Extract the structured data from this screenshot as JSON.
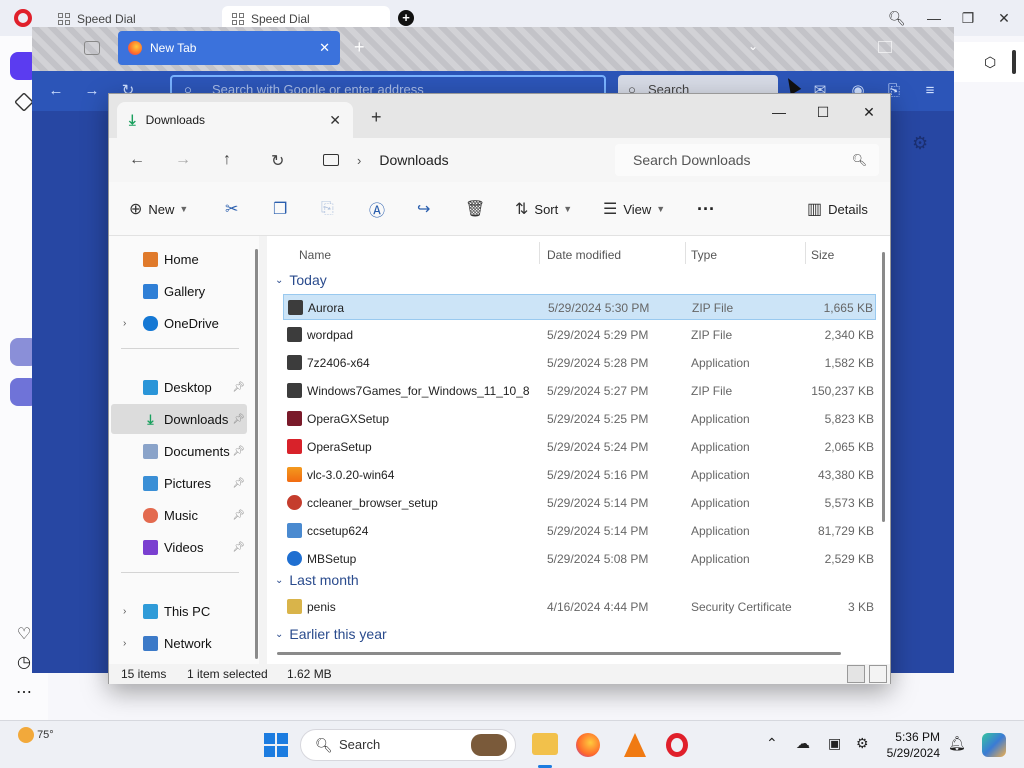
{
  "opera": {
    "tabs": [
      {
        "label": "Speed Dial"
      },
      {
        "label": "Speed Dial"
      }
    ]
  },
  "firefox": {
    "tab_label": "New Tab",
    "url_placeholder": "Search with Google or enter address",
    "search_placeholder": "Search"
  },
  "explorer": {
    "tab_label": "Downloads",
    "breadcrumb": "Downloads",
    "search_placeholder": "Search Downloads",
    "commands": {
      "new": "New",
      "sort": "Sort",
      "view": "View",
      "more": "···",
      "details": "Details"
    },
    "nav": [
      {
        "label": "Home"
      },
      {
        "label": "Gallery"
      },
      {
        "label": "OneDrive"
      },
      {
        "label": "Desktop"
      },
      {
        "label": "Downloads"
      },
      {
        "label": "Documents"
      },
      {
        "label": "Pictures"
      },
      {
        "label": "Music"
      },
      {
        "label": "Videos"
      },
      {
        "label": "This PC"
      },
      {
        "label": "Network"
      }
    ],
    "columns": {
      "name": "Name",
      "date": "Date modified",
      "type": "Type",
      "size": "Size"
    },
    "groups": {
      "today": "Today",
      "last_month": "Last month",
      "earlier": "Earlier this year"
    },
    "files": [
      {
        "name": "Aurora",
        "date": "5/29/2024 5:30 PM",
        "type": "ZIP File",
        "size": "1,665 KB"
      },
      {
        "name": "wordpad",
        "date": "5/29/2024 5:29 PM",
        "type": "ZIP File",
        "size": "2,340 KB"
      },
      {
        "name": "7z2406-x64",
        "date": "5/29/2024 5:28 PM",
        "type": "Application",
        "size": "1,582 KB"
      },
      {
        "name": "Windows7Games_for_Windows_11_10_8",
        "date": "5/29/2024 5:27 PM",
        "type": "ZIP File",
        "size": "150,237 KB"
      },
      {
        "name": "OperaGXSetup",
        "date": "5/29/2024 5:25 PM",
        "type": "Application",
        "size": "5,823 KB"
      },
      {
        "name": "OperaSetup",
        "date": "5/29/2024 5:24 PM",
        "type": "Application",
        "size": "2,065 KB"
      },
      {
        "name": "vlc-3.0.20-win64",
        "date": "5/29/2024 5:16 PM",
        "type": "Application",
        "size": "43,380 KB"
      },
      {
        "name": "ccleaner_browser_setup",
        "date": "5/29/2024 5:14 PM",
        "type": "Application",
        "size": "5,573 KB"
      },
      {
        "name": "ccsetup624",
        "date": "5/29/2024 5:14 PM",
        "type": "Application",
        "size": "81,729 KB"
      },
      {
        "name": "MBSetup",
        "date": "5/29/2024 5:08 PM",
        "type": "Application",
        "size": "2,529 KB"
      },
      {
        "name": "penis",
        "date": "4/16/2024 4:44 PM",
        "type": "Security Certificate",
        "size": "3 KB"
      }
    ],
    "status": {
      "items": "15 items",
      "selected": "1 item selected",
      "size": "1.62 MB"
    }
  },
  "taskbar": {
    "weather": "75°",
    "search_label": "Search",
    "time": "5:36 PM",
    "date": "5/29/2024"
  }
}
